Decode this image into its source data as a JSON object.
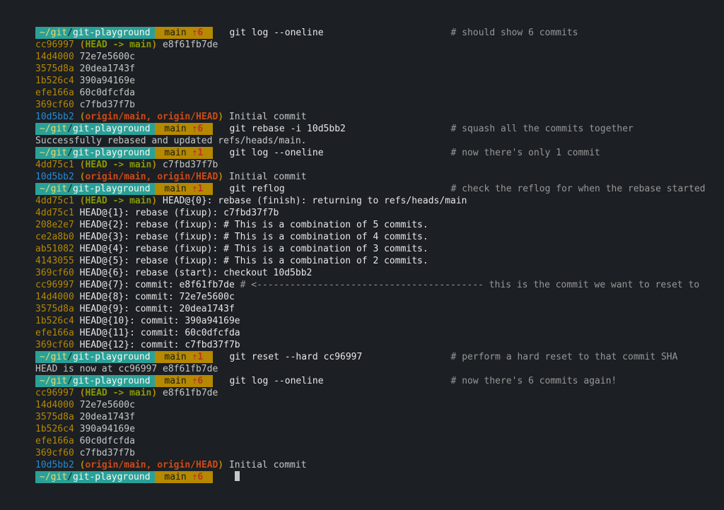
{
  "lines": [
    {
      "t": "prompt",
      "path": "~/git/git-playground",
      "branch": "main",
      "ahead": "⇡6",
      "cmd": "git log --oneline",
      "comment": "# should show 6 commits",
      "cc": 78
    },
    {
      "t": "commit",
      "hash": "cc96997",
      "head": 1,
      "msg": "e8f61fb7de"
    },
    {
      "t": "commit",
      "hash": "14d4000",
      "msg": "72e7e5600c"
    },
    {
      "t": "commit",
      "hash": "3575d8a",
      "msg": "20dea1743f"
    },
    {
      "t": "commit",
      "hash": "1b526c4",
      "msg": "390a94169e"
    },
    {
      "t": "commit",
      "hash": "efe166a",
      "msg": "60c0dfcfda"
    },
    {
      "t": "commit",
      "hash": "369cf60",
      "msg": "c7fbd37f7b"
    },
    {
      "t": "commit",
      "hash": "10d5bb2",
      "remote": 1,
      "hashc": "b",
      "msg": "Initial commit"
    },
    {
      "t": "prompt",
      "path": "~/git/git-playground",
      "branch": "main",
      "ahead": "⇡6",
      "cmd": "git rebase -i 10d5bb2",
      "comment": "# squash all the commits together",
      "cc": 78
    },
    {
      "t": "plain",
      "text": "Successfully rebased and updated refs/heads/main."
    },
    {
      "t": "prompt",
      "path": "~/git/git-playground",
      "branch": "main",
      "ahead": "⇡1",
      "cmd": "git log --oneline",
      "comment": "# now there's only 1 commit",
      "cc": 78
    },
    {
      "t": "commit",
      "hash": "4dd75c1",
      "head": 1,
      "msg": "c7fbd37f7b"
    },
    {
      "t": "commit",
      "hash": "10d5bb2",
      "remote": 1,
      "hashc": "b",
      "msg": "Initial commit"
    },
    {
      "t": "prompt",
      "path": "~/git/git-playground",
      "branch": "main",
      "ahead": "⇡1",
      "cmd": "git reflog",
      "comment": "# check the reflog for when the rebase started",
      "cc": 78
    },
    {
      "t": "reflog",
      "hash": "4dd75c1",
      "head": 1,
      "idx": 0,
      "action": "rebase (finish): returning to refs/heads/main"
    },
    {
      "t": "reflog",
      "hash": "4dd75c1",
      "idx": 1,
      "action": "rebase (fixup): c7fbd37f7b"
    },
    {
      "t": "reflog",
      "hash": "208e2e7",
      "idx": 2,
      "action": "rebase (fixup): # This is a combination of 5 commits."
    },
    {
      "t": "reflog",
      "hash": "ce2a8b0",
      "idx": 3,
      "action": "rebase (fixup): # This is a combination of 4 commits."
    },
    {
      "t": "reflog",
      "hash": "ab51082",
      "idx": 4,
      "action": "rebase (fixup): # This is a combination of 3 commits."
    },
    {
      "t": "reflog",
      "hash": "4143055",
      "idx": 5,
      "action": "rebase (fixup): # This is a combination of 2 commits."
    },
    {
      "t": "reflog",
      "hash": "369cf60",
      "idx": 6,
      "action": "rebase (start): checkout 10d5bb2"
    },
    {
      "t": "reflog",
      "hash": "cc96997",
      "idx": 7,
      "action": "commit: e8f61fb7de",
      "hashc": "y",
      "arrow": "# <----------------------------------------- this is the commit we want to reset to"
    },
    {
      "t": "reflog",
      "hash": "14d4000",
      "idx": 8,
      "action": "commit: 72e7e5600c"
    },
    {
      "t": "reflog",
      "hash": "3575d8a",
      "idx": 9,
      "action": "commit: 20dea1743f"
    },
    {
      "t": "reflog",
      "hash": "1b526c4",
      "idx": 10,
      "action": "commit: 390a94169e"
    },
    {
      "t": "reflog",
      "hash": "efe166a",
      "idx": 11,
      "action": "commit: 60c0dfcfda"
    },
    {
      "t": "reflog",
      "hash": "369cf60",
      "idx": 12,
      "action": "commit: c7fbd37f7b"
    },
    {
      "t": "prompt",
      "path": "~/git/git-playground",
      "branch": "main",
      "ahead": "⇡1",
      "cmd": "git reset --hard cc96997",
      "comment": "# perform a hard reset to that commit SHA",
      "cc": 78
    },
    {
      "t": "plain",
      "text": "HEAD is now at cc96997 e8f61fb7de"
    },
    {
      "t": "prompt",
      "path": "~/git/git-playground",
      "branch": "main",
      "ahead": "⇡6",
      "cmd": "git log --oneline",
      "comment": "# now there's 6 commits again!",
      "cc": 78
    },
    {
      "t": "commit",
      "hash": "cc96997",
      "head": 1,
      "msg": "e8f61fb7de"
    },
    {
      "t": "commit",
      "hash": "14d4000",
      "msg": "72e7e5600c"
    },
    {
      "t": "commit",
      "hash": "3575d8a",
      "msg": "20dea1743f"
    },
    {
      "t": "commit",
      "hash": "1b526c4",
      "msg": "390a94169e"
    },
    {
      "t": "commit",
      "hash": "efe166a",
      "msg": "60c0dfcfda"
    },
    {
      "t": "commit",
      "hash": "369cf60",
      "msg": "c7fbd37f7b"
    },
    {
      "t": "commit",
      "hash": "10d5bb2",
      "remote": 1,
      "hashc": "b",
      "msg": "Initial commit"
    },
    {
      "t": "prompt",
      "path": "~/git/git-playground",
      "branch": "main",
      "ahead": "⇡6",
      "cmd": "",
      "cursor": 1
    }
  ],
  "refs": {
    "head": "HEAD -> main",
    "remote": "origin/main, origin/HEAD"
  }
}
